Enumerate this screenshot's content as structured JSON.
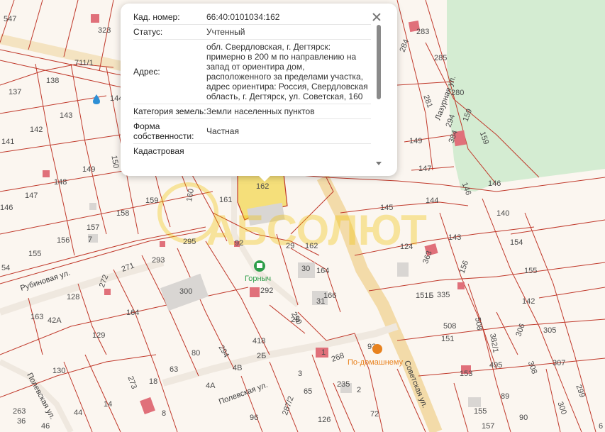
{
  "popup": {
    "rows": [
      {
        "key": "Кад. номер:",
        "value": "66:40:0101034:162"
      },
      {
        "key": "Статус:",
        "value": "Учтенный"
      },
      {
        "key": "Адрес:",
        "value": "обл. Свердловская, г. Дегтярск: примерно в 200 м по направлению на запад от ориентира дом, расположенного за пределами участка, адрес ориентира: Россия, Свердловская область, г. Дегтярск, ул. Советская, 160"
      },
      {
        "key": "Категория земель:",
        "value": "Земли населенных пунктов"
      },
      {
        "key": "Форма собственности:",
        "value": "Частная"
      },
      {
        "key": "Кадастровая",
        "value": ""
      }
    ]
  },
  "streets": {
    "rubinovaya": "Рубиновая ул.",
    "polevskaya_left": "Полевская ул.",
    "polevskaya_mid": "Полевская ул.",
    "sovetskaya": "Советская ул.",
    "lazurnaya": "Лазурная ул."
  },
  "pois": {
    "gornyach": "Горныч",
    "podomashnemu": "По-домашнему"
  },
  "colors": {
    "plot_line": "#c0392b",
    "selected_fill": "#f5df7a",
    "road": "#f2d9a6",
    "forest": "#d4ecd2",
    "building_red": "#e0707a",
    "building_grey": "#d9d6d3",
    "poi_green": "#2e9e4a",
    "poi_orange": "#e8821e"
  },
  "plots": [
    "547",
    "323",
    "711/1",
    "138",
    "137",
    "143",
    "142",
    "141",
    "144",
    "150",
    "149",
    "148",
    "147",
    "146",
    "283",
    "284",
    "285",
    "281",
    "280",
    "159",
    "159",
    "294",
    "384",
    "149",
    "147",
    "146",
    "146",
    "140",
    "154",
    "155",
    "144",
    "145",
    "143",
    "124",
    "363",
    "162",
    "160",
    "161",
    "159",
    "158",
    "157",
    "7",
    "156",
    "155",
    "54",
    "295",
    "293",
    "271",
    "272",
    "128",
    "163",
    "42А",
    "92",
    "29",
    "162",
    "30",
    "164",
    "31",
    "166",
    "300",
    "292",
    "290",
    "2Б",
    "164",
    "129",
    "130",
    "80",
    "294",
    "418",
    "2Б",
    "63",
    "4В",
    "18",
    "273",
    "4А",
    "3",
    "65",
    "1",
    "268",
    "235",
    "93",
    "2",
    "96",
    "287/2",
    "126",
    "72",
    "44",
    "14",
    "263",
    "36",
    "46",
    "8",
    "156",
    "335",
    "151Б",
    "508",
    "151",
    "306",
    "305",
    "142",
    "508",
    "382/1",
    "495",
    "153",
    "308",
    "307",
    "299",
    "89",
    "90",
    "300",
    "155",
    "157",
    "6"
  ],
  "watermark": "АБСОЛЮТ"
}
